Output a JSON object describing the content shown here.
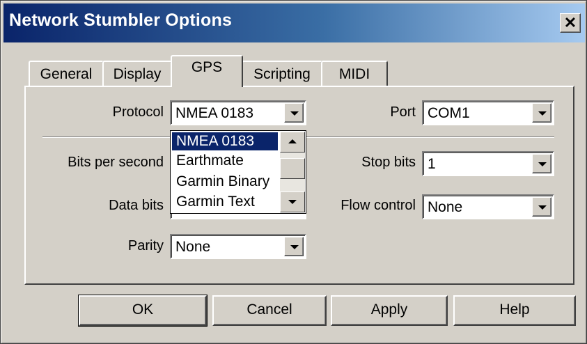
{
  "window": {
    "title": "Network Stumbler Options",
    "close_glyph": "✕"
  },
  "tabs": [
    {
      "label": "General",
      "active": false
    },
    {
      "label": "Display",
      "active": false
    },
    {
      "label": "GPS",
      "active": true
    },
    {
      "label": "Scripting",
      "active": false
    },
    {
      "label": "MIDI",
      "active": false
    }
  ],
  "gps": {
    "protocol": {
      "label": "Protocol",
      "value": "NMEA 0183"
    },
    "port": {
      "label": "Port",
      "value": "COM1"
    },
    "bits_per_second": {
      "label": "Bits per second"
    },
    "stop_bits": {
      "label": "Stop bits",
      "value": "1"
    },
    "data_bits": {
      "label": "Data bits"
    },
    "flow_control": {
      "label": "Flow control",
      "value": "None"
    },
    "parity": {
      "label": "Parity",
      "value": "None"
    }
  },
  "protocol_dropdown": {
    "options": [
      "NMEA 0183",
      "Earthmate",
      "Garmin Binary",
      "Garmin Text"
    ],
    "selected": "NMEA 0183"
  },
  "buttons": {
    "ok": "OK",
    "cancel": "Cancel",
    "apply": "Apply",
    "help": "Help"
  },
  "icons": {
    "close": "close-icon",
    "dropdown": "chevron-down-icon",
    "scroll_up": "scroll-up-icon",
    "scroll_down": "scroll-down-icon"
  },
  "colors": {
    "titlebar_start": "#0a246a",
    "titlebar_end": "#a6caf0",
    "dialog_bg": "#d4d0c8",
    "selection": "#0a246a"
  }
}
